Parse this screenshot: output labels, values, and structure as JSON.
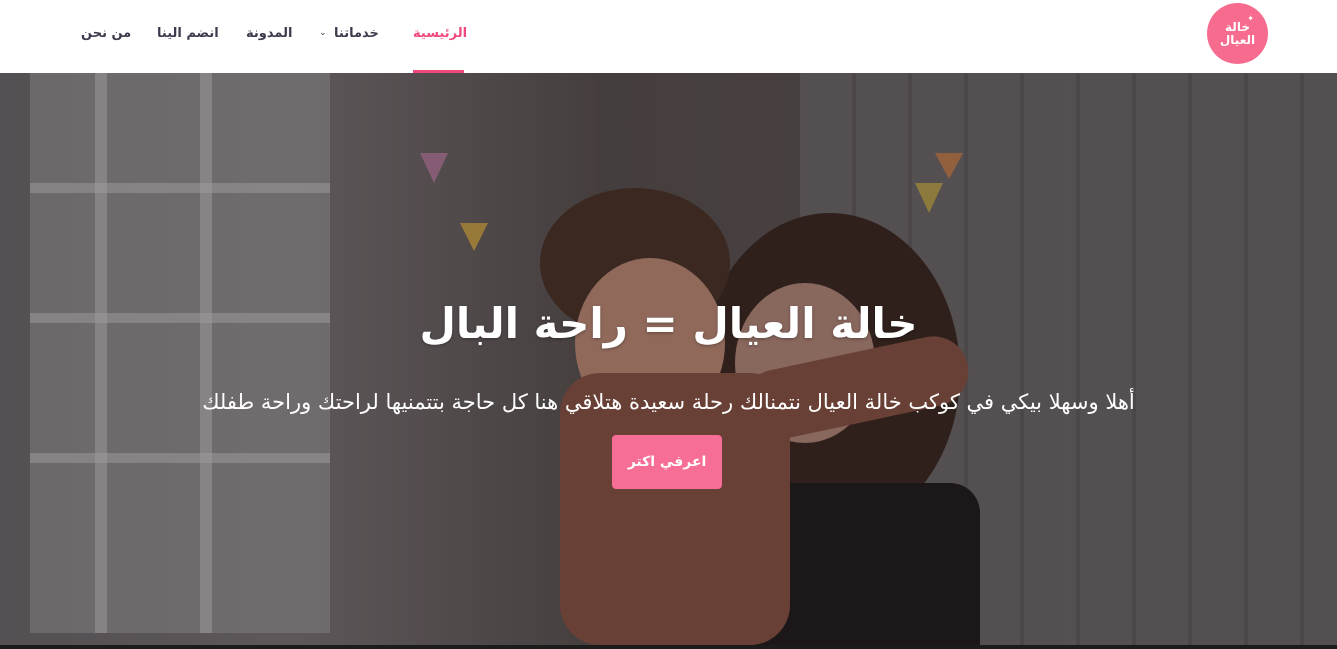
{
  "logo": {
    "line1": "خالة",
    "line2": "العيال",
    "star": "✦"
  },
  "nav": {
    "items": [
      {
        "label": "الرئيسية",
        "active": true
      },
      {
        "label": "خدماتنا",
        "has_dropdown": true
      },
      {
        "label": "المدونة"
      },
      {
        "label": "انضم الينا"
      },
      {
        "label": "من نحن"
      }
    ],
    "dropdown_icon": "⌄"
  },
  "hero": {
    "title": "خالة العيال = راحة البال",
    "subtitle": "أهلا وسهلا بيكي في كوكب خالة العيال نتمنالك رحلة سعيدة هتلاقي هنا كل حاجة بتتمنيها لراحتك وراحة طفلك",
    "cta_label": "اعرفي اكتر"
  },
  "colors": {
    "accent": "#ef4a7b",
    "logo_bg": "#f76b8f",
    "button_bg": "#f66e95",
    "nav_text": "#3b3b4d"
  }
}
